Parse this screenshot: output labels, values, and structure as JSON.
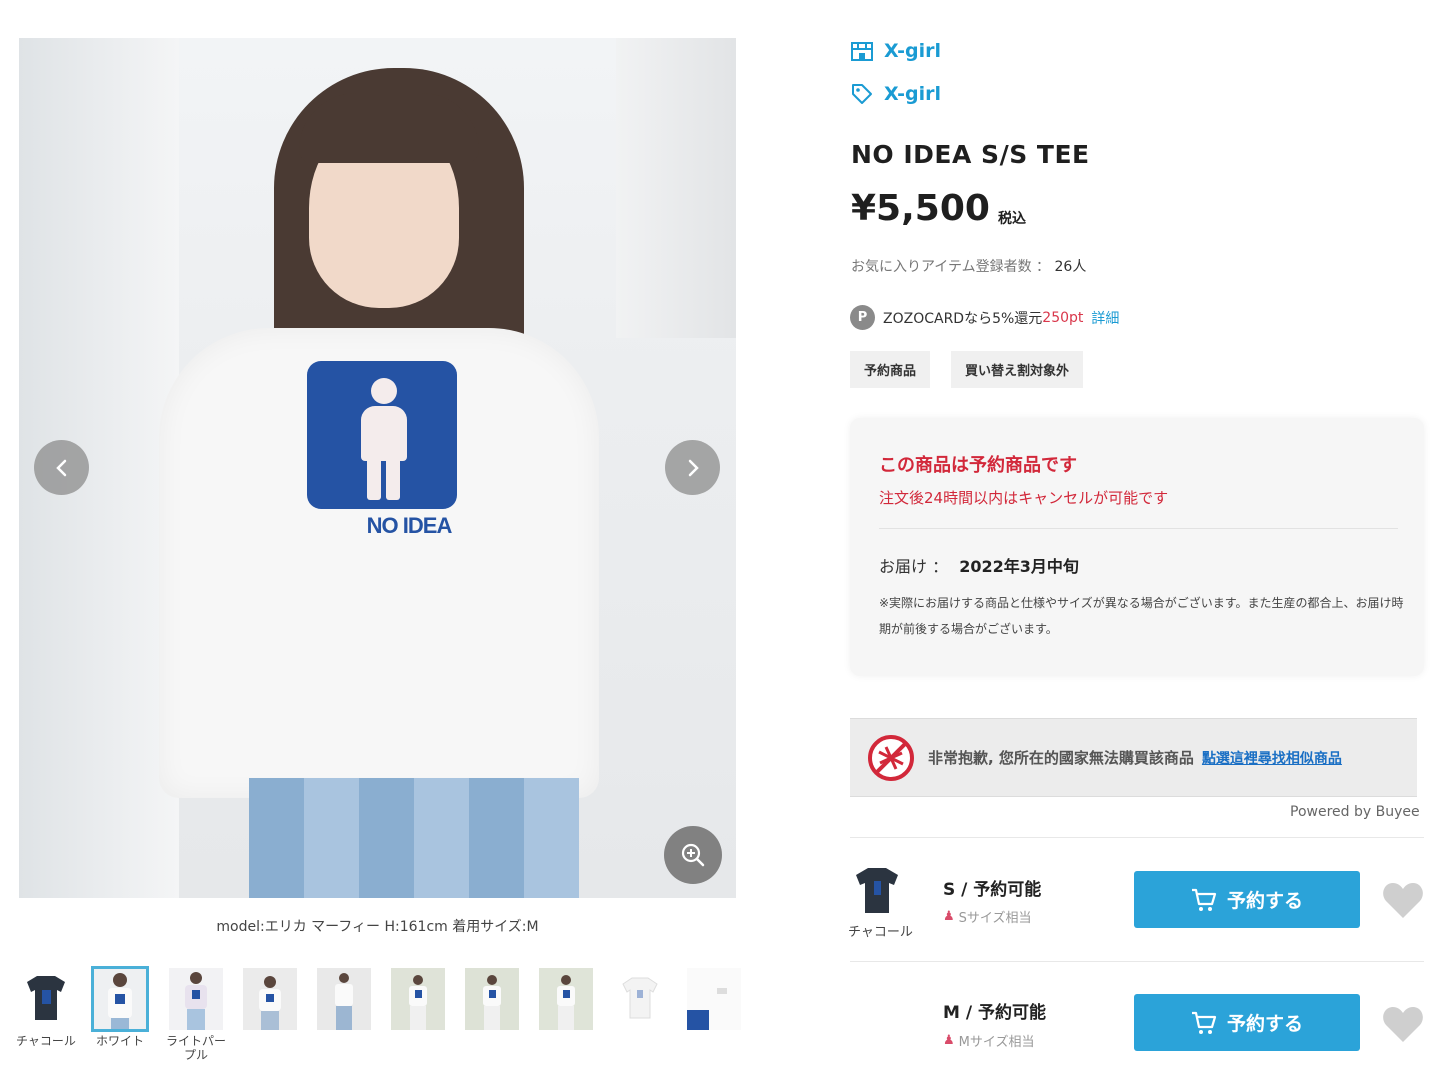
{
  "gallery": {
    "caption": "model:エリカ マーフィー H:161cm 着用サイズ:M",
    "print_text": "NO IDEA",
    "print_logo": "X-girl",
    "thumbnails": [
      {
        "label": "チャコール",
        "selected": false,
        "tone": "#2b3440"
      },
      {
        "label": "ホワイト",
        "selected": true,
        "tone": "#f5f5f5"
      },
      {
        "label": "ライトパープル",
        "selected": false,
        "tone": "#e8e2ee"
      },
      {
        "label": "",
        "selected": false,
        "tone": "#eeeeee"
      },
      {
        "label": "",
        "selected": false,
        "tone": "#e9e9e9"
      },
      {
        "label": "",
        "selected": false,
        "tone": "#e6e6e2"
      },
      {
        "label": "",
        "selected": false,
        "tone": "#e4e5e2"
      },
      {
        "label": "",
        "selected": false,
        "tone": "#e5e6e3"
      },
      {
        "label": "",
        "selected": false,
        "tone": "#ffffff"
      },
      {
        "label": "",
        "selected": false,
        "tone": "#ffffff"
      }
    ]
  },
  "brand": {
    "shop_name": "X-girl",
    "brand_name": "X-girl"
  },
  "product": {
    "name": "NO IDEA S/S TEE",
    "price": "¥5,500",
    "tax_label": "税込",
    "favorites_label": "お気に入りアイテム登録者数 ：",
    "favorites_count": "26人"
  },
  "points": {
    "badge": "P",
    "text": "ZOZOCARDなら5%還元",
    "amount": "250pt",
    "detail_link": "詳細"
  },
  "tags": [
    "予約商品",
    "買い替え割対象外"
  ],
  "reservation": {
    "title": "この商品は予約商品です",
    "subtitle": "注文後24時間以内はキャンセルが可能です",
    "delivery_label": "お届け ：",
    "delivery_date": "2022年3月中旬",
    "note": "※実際にお届けする商品と仕様やサイズが異なる場合がございます。また生産の都合上、お届け時期が前後する場合がございます。"
  },
  "buyee": {
    "message": "非常抱歉, 您所在的國家無法購買該商品",
    "link": "點選這裡尋找相似商品",
    "powered": "Powered by Buyee"
  },
  "variants": {
    "color_label": "チャコール",
    "sizes": [
      {
        "size": "S / 予約可能",
        "hint": "Sサイズ相当",
        "button": "予約する"
      },
      {
        "size": "M / 予約可能",
        "hint": "Mサイズ相当",
        "button": "予約する"
      }
    ]
  },
  "colors": {
    "accent": "#1a9bd3",
    "button": "#2ba3d9",
    "alert": "#d2283a",
    "points": "#d9374b"
  }
}
